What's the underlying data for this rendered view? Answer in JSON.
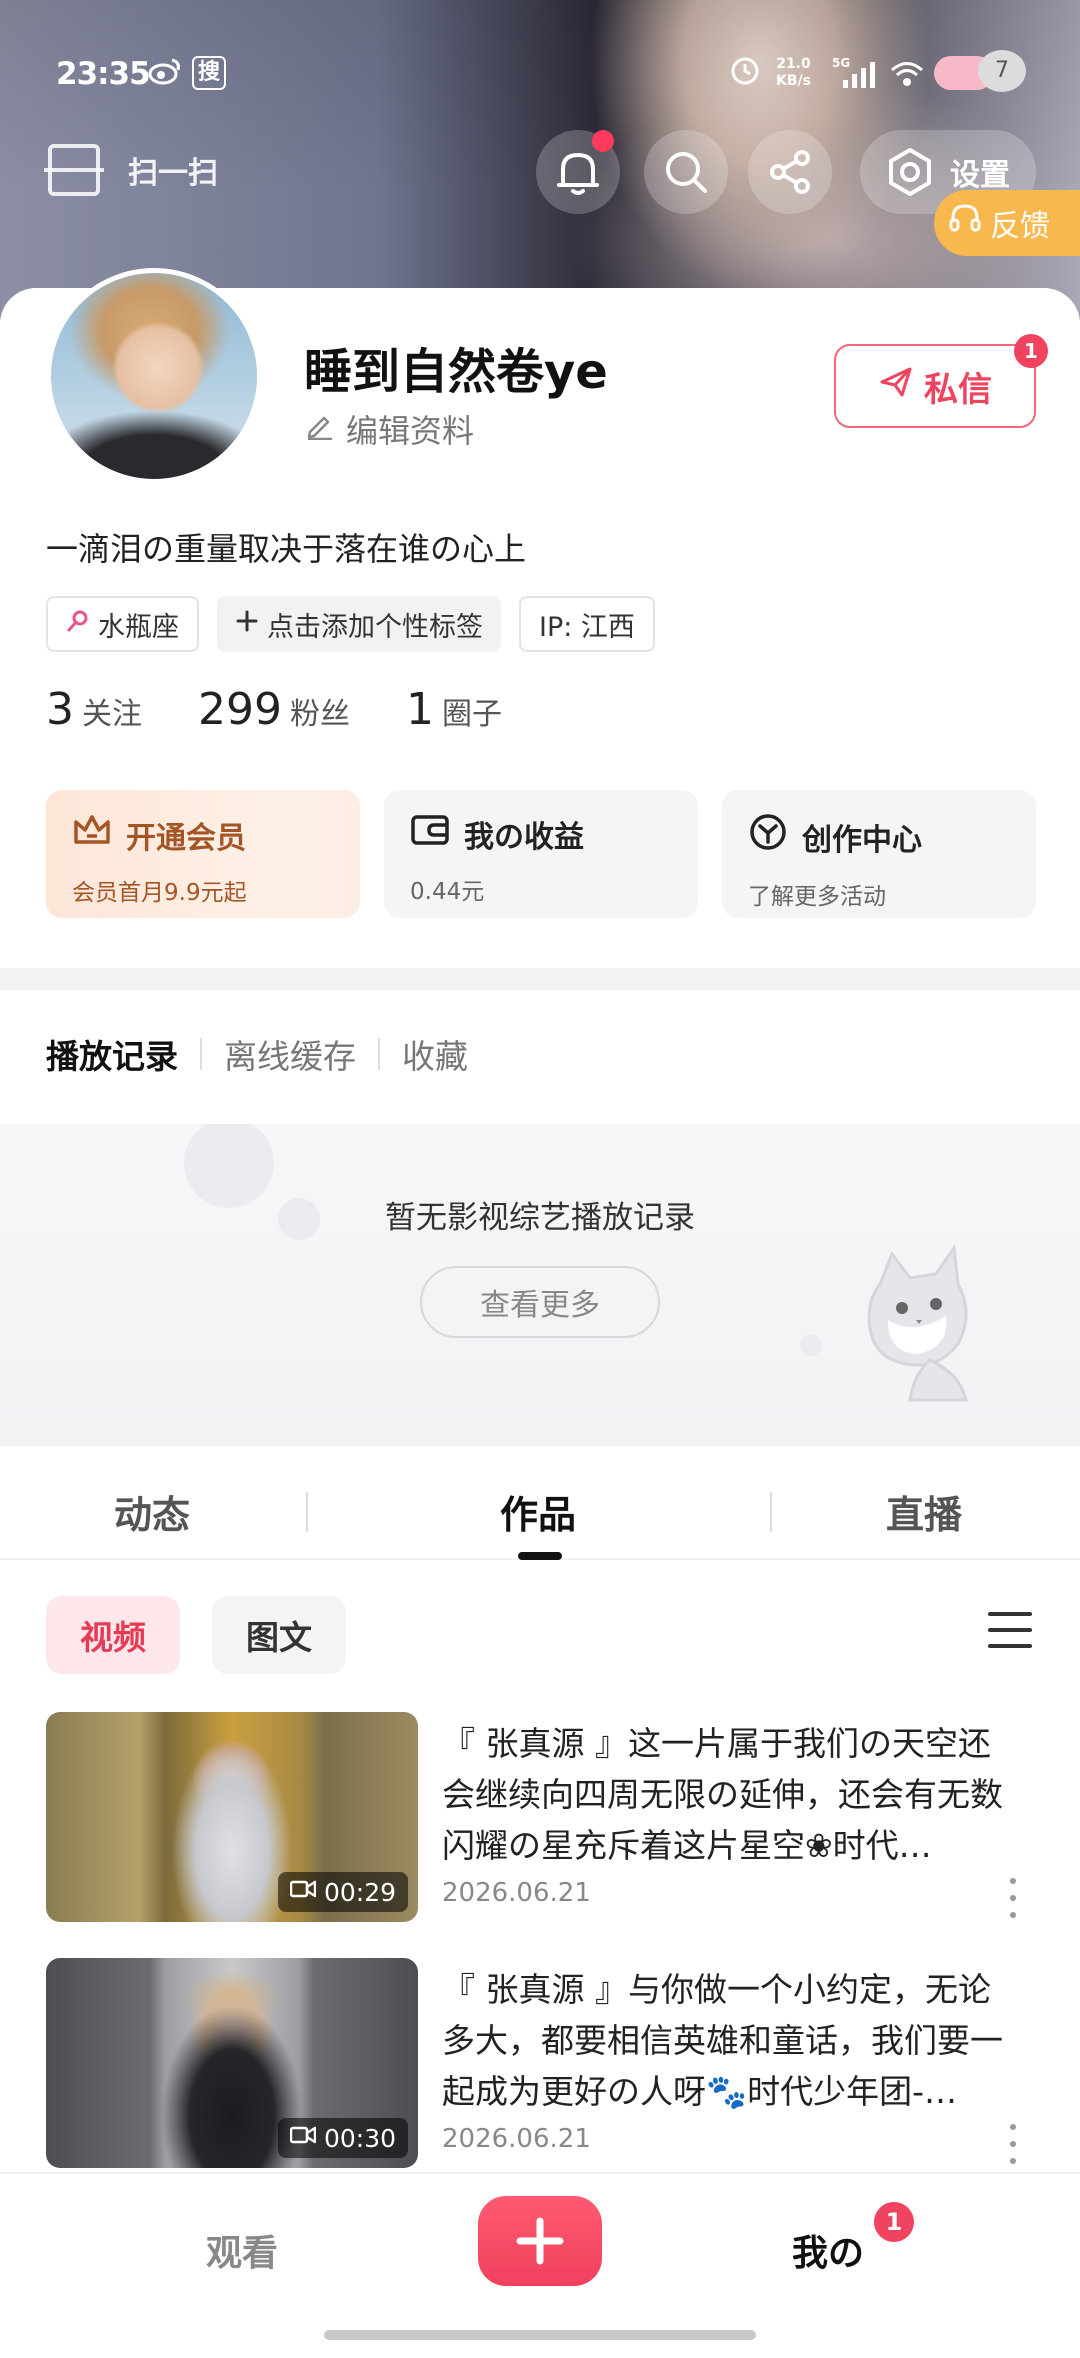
{
  "status_bar": {
    "time": "23:35",
    "weibo_icon": "weibo-icon",
    "search_badge": "搜",
    "speed_value": "21.0",
    "speed_unit": "KB/s",
    "network": "5G",
    "battery_level": "7"
  },
  "top_bar": {
    "scan_label": "扫一扫",
    "settings_label": "设置",
    "feedback_label": "反馈"
  },
  "profile": {
    "username": "睡到自然卷ye",
    "edit_label": "编辑资料",
    "dm_label": "私信",
    "dm_badge": "1",
    "bio": "一滴泪の重量取决于落在谁の心上",
    "tags": [
      {
        "label": "水瓶座",
        "icon": "aquarius-icon"
      },
      {
        "label": "点击添加个性标签",
        "icon": "plus-icon"
      },
      {
        "label": "IP: 江西",
        "icon": ""
      }
    ],
    "stats": [
      {
        "num": "3",
        "label": "关注"
      },
      {
        "num": "299",
        "label": "粉丝"
      },
      {
        "num": "1",
        "label": "圈子"
      }
    ]
  },
  "features": [
    {
      "title": "开通会员",
      "sub": "会员首月9.9元起",
      "icon": "crown-icon"
    },
    {
      "title": "我の收益",
      "sub": "0.44元",
      "icon": "wallet-icon"
    },
    {
      "title": "创作中心",
      "sub": "了解更多活动",
      "icon": "creator-icon"
    }
  ],
  "history": {
    "tabs": [
      "播放记录",
      "离线缓存",
      "收藏"
    ],
    "active_tab": 0,
    "empty_text": "暂无影视综艺播放记录",
    "more_label": "查看更多"
  },
  "content_tabs": {
    "items": [
      "动态",
      "作品",
      "直播"
    ],
    "active": 1
  },
  "filters": {
    "items": [
      "视频",
      "图文"
    ],
    "active": 0
  },
  "videos": [
    {
      "title": "『 张真源 』这一片属于我们の天空还会继续向四周无限の延伸，还会有无数闪耀の星充斥着这片星空❀时代…",
      "date": "2026.06.21",
      "duration": "00:29"
    },
    {
      "title": "『 张真源 』与你做一个小约定，无论多大，都要相信英雄和童话，我们要一起成为更好の人呀🐾时代少年团-…",
      "date": "2026.06.21",
      "duration": "00:30"
    }
  ],
  "bottom_nav": {
    "watch_label": "观看",
    "me_label": "我の",
    "me_badge": "1"
  },
  "colors": {
    "accent": "#f0435f",
    "vip_text": "#a35526",
    "feedback_bg": "#f8b84e"
  }
}
